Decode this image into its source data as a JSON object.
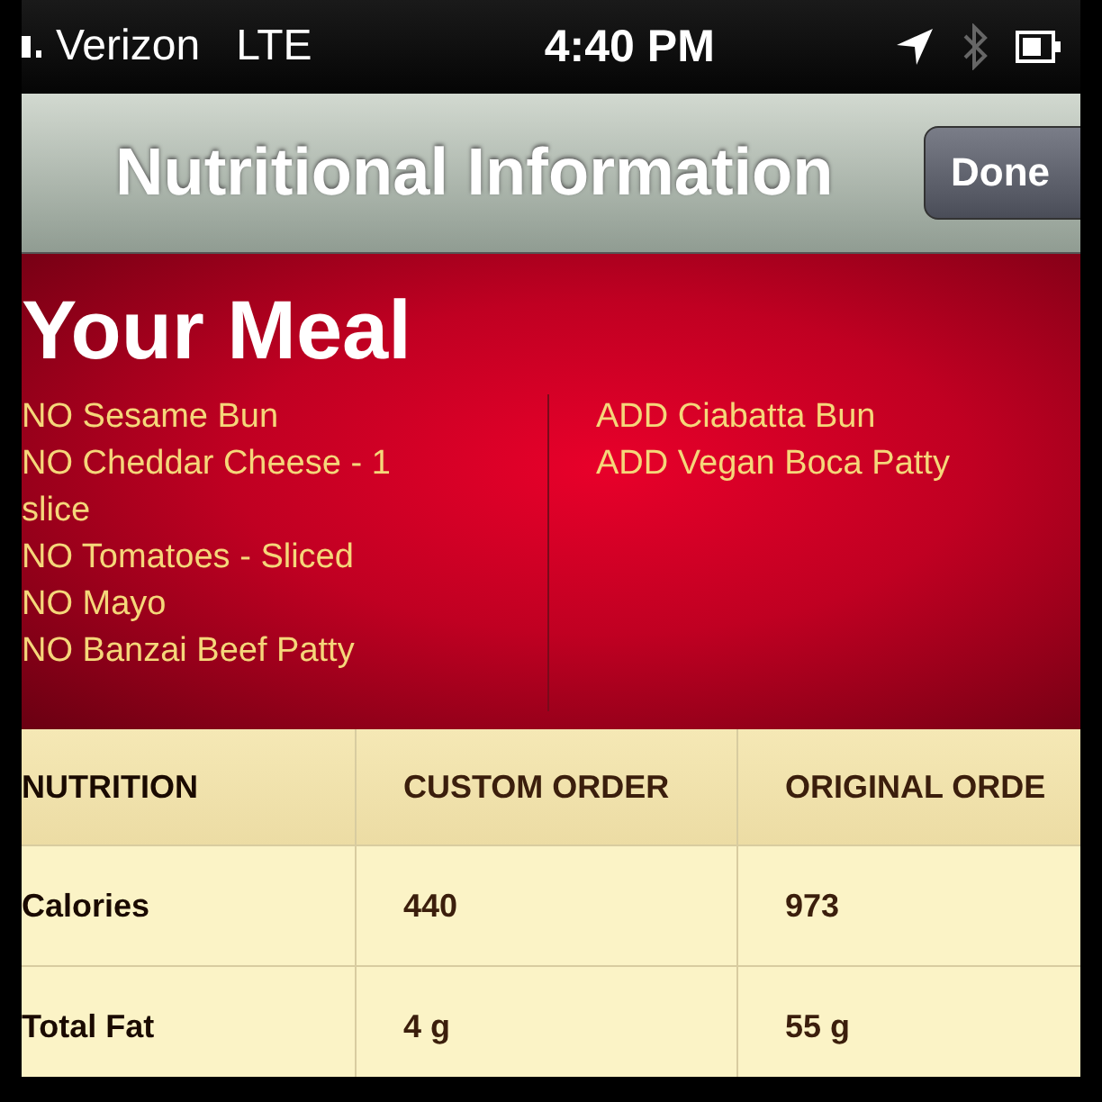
{
  "status_bar": {
    "carrier": "Verizon",
    "network": "LTE",
    "time": "4:40 PM"
  },
  "nav_bar": {
    "title": "Nutritional Information",
    "done_button": "Done"
  },
  "meal": {
    "title": "Your Meal",
    "removed": [
      "NO Sesame Bun",
      "NO Cheddar Cheese - 1 slice",
      "NO Tomatoes - Sliced",
      "NO Mayo",
      "NO Banzai Beef Patty"
    ],
    "added": [
      "ADD Ciabatta Bun",
      "ADD Vegan Boca Patty"
    ]
  },
  "table": {
    "columns": [
      "NUTRITION",
      "CUSTOM ORDER",
      "ORIGINAL ORDE"
    ],
    "rows": [
      [
        "Calories",
        "440",
        "973"
      ],
      [
        "Total Fat",
        "4 g",
        "55 g"
      ]
    ]
  }
}
